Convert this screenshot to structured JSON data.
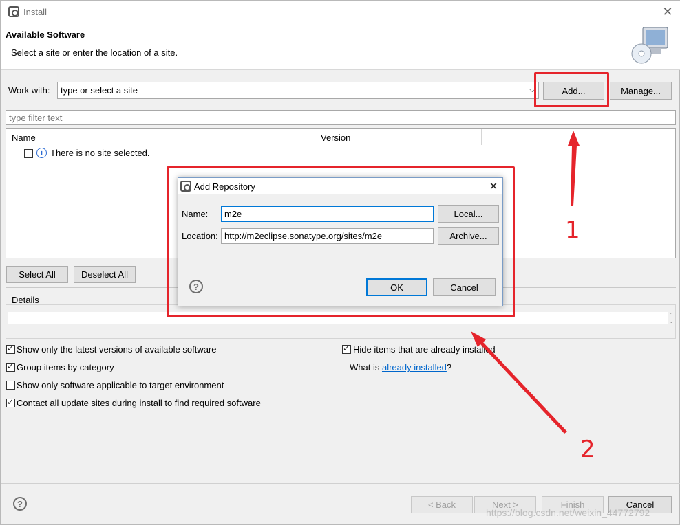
{
  "window": {
    "title": "Install"
  },
  "header": {
    "title": "Available Software",
    "subtitle": "Select a site or enter the location of a site."
  },
  "work_with": {
    "label": "Work with:",
    "value": "type or select a site",
    "add_label": "Add...",
    "manage_label": "Manage..."
  },
  "filter": {
    "placeholder": "type filter text"
  },
  "table": {
    "columns": [
      "Name",
      "Version"
    ],
    "empty_message": "There is no site selected."
  },
  "selection": {
    "select_all": "Select All",
    "deselect_all": "Deselect All"
  },
  "details": {
    "label": "Details"
  },
  "options": {
    "latest_only": {
      "label": "Show only the latest versions of available software",
      "checked": true
    },
    "group_by_category": {
      "label": "Group items by category",
      "checked": true
    },
    "target_env": {
      "label": "Show only software applicable to target environment",
      "checked": false
    },
    "contact_sites": {
      "label": "Contact all update sites during install to find required software",
      "checked": true
    },
    "hide_installed": {
      "label": "Hide items that are already installed",
      "checked": true
    },
    "what_is_prefix": "What is ",
    "what_is_link": "already installed",
    "what_is_suffix": "?"
  },
  "footer": {
    "back": "< Back",
    "next": "Next >",
    "finish": "Finish",
    "cancel": "Cancel",
    "watermark": "https://blog.csdn.net/weixin_44772792"
  },
  "dialog": {
    "title": "Add Repository",
    "name_label": "Name:",
    "name_value": "m2e",
    "location_label": "Location:",
    "location_value": "http://m2eclipse.sonatype.org/sites/m2e",
    "local_label": "Local...",
    "archive_label": "Archive...",
    "ok_label": "OK",
    "cancel_label": "Cancel"
  },
  "annotations": {
    "marker_1": "1",
    "marker_2": "2",
    "color": "#e5242b"
  },
  "icons": [
    "eclipse-app-icon",
    "close-icon",
    "software-cd-icon",
    "info-icon",
    "help-icon",
    "dropdown-chevron-icon"
  ]
}
